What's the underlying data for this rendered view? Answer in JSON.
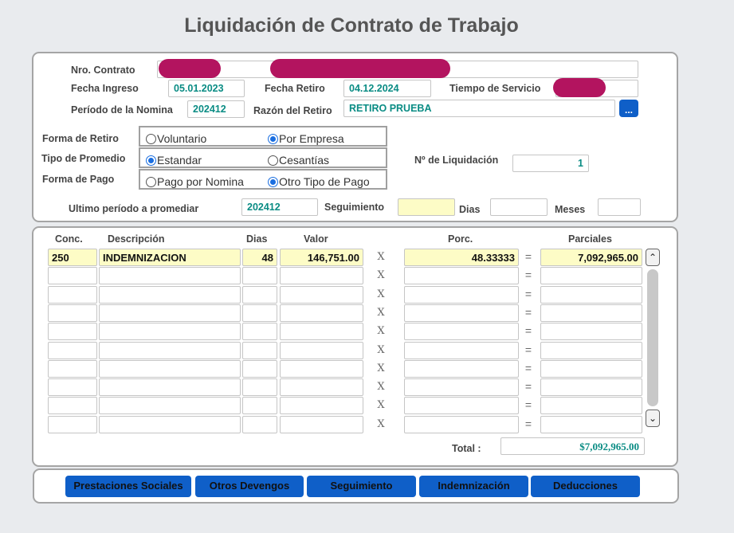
{
  "title": "Liquidación de Contrato de Trabajo",
  "header": {
    "nro_contrato_label": "Nro. Contrato",
    "fecha_ingreso_label": "Fecha Ingreso",
    "fecha_ingreso": "05.01.2023",
    "fecha_retiro_label": "Fecha  Retiro",
    "fecha_retiro": "04.12.2024",
    "tiempo_servicio_label": "Tiempo de Servicio",
    "periodo_nomina_label": "Período de la Nomina",
    "periodo_nomina": "202412",
    "razon_retiro_label": "Razón del Retiro",
    "razon_retiro": "RETIRO PRUEBA",
    "lookup_button": "...",
    "forma_retiro_label": "Forma de Retiro",
    "forma_retiro_options": [
      "Voluntario",
      "Por Empresa"
    ],
    "tipo_promedio_label": "Tipo de Promedio",
    "tipo_promedio_options": [
      "Estandar",
      "Cesantías"
    ],
    "forma_pago_label": "Forma de Pago",
    "forma_pago_options": [
      "Pago por Nomina",
      "Otro Tipo de Pago"
    ],
    "nro_liquidacion_label": "Nº de Liquidación",
    "nro_liquidacion": "1",
    "ultimo_periodo_label": "Ultimo período a promediar",
    "ultimo_periodo": "202412",
    "seguimiento_label": "Seguimiento",
    "dias_label": "Dias",
    "meses_label": "Meses"
  },
  "table": {
    "columns": {
      "conc": "Conc.",
      "descripcion": "Descripción",
      "dias": "Dias",
      "valor": "Valor",
      "porc": "Porc.",
      "parciales": "Parciales"
    },
    "times_symbol": "X",
    "equals_symbol": "=",
    "rows": [
      {
        "conc": "250",
        "descripcion": "INDEMNIZACION",
        "dias": "48",
        "valor": "146,751.00",
        "porc": "48.33333",
        "parciales": "7,092,965.00"
      },
      {
        "conc": "",
        "descripcion": "",
        "dias": "",
        "valor": "",
        "porc": "",
        "parciales": ""
      },
      {
        "conc": "",
        "descripcion": "",
        "dias": "",
        "valor": "",
        "porc": "",
        "parciales": ""
      },
      {
        "conc": "",
        "descripcion": "",
        "dias": "",
        "valor": "",
        "porc": "",
        "parciales": ""
      },
      {
        "conc": "",
        "descripcion": "",
        "dias": "",
        "valor": "",
        "porc": "",
        "parciales": ""
      },
      {
        "conc": "",
        "descripcion": "",
        "dias": "",
        "valor": "",
        "porc": "",
        "parciales": ""
      },
      {
        "conc": "",
        "descripcion": "",
        "dias": "",
        "valor": "",
        "porc": "",
        "parciales": ""
      },
      {
        "conc": "",
        "descripcion": "",
        "dias": "",
        "valor": "",
        "porc": "",
        "parciales": ""
      },
      {
        "conc": "",
        "descripcion": "",
        "dias": "",
        "valor": "",
        "porc": "",
        "parciales": ""
      },
      {
        "conc": "",
        "descripcion": "",
        "dias": "",
        "valor": "",
        "porc": "",
        "parciales": ""
      }
    ],
    "total_label": "Total :",
    "total": "$7,092,965.00"
  },
  "buttons": [
    "Prestaciones Sociales",
    "Otros Devengos",
    "Seguimiento",
    "Indemnización",
    "Deducciones"
  ],
  "colors": {
    "accent": "#0f5fc8",
    "value_text": "#0a8c84",
    "highlight": "#fdfcc6",
    "redaction": "#b3145f"
  }
}
